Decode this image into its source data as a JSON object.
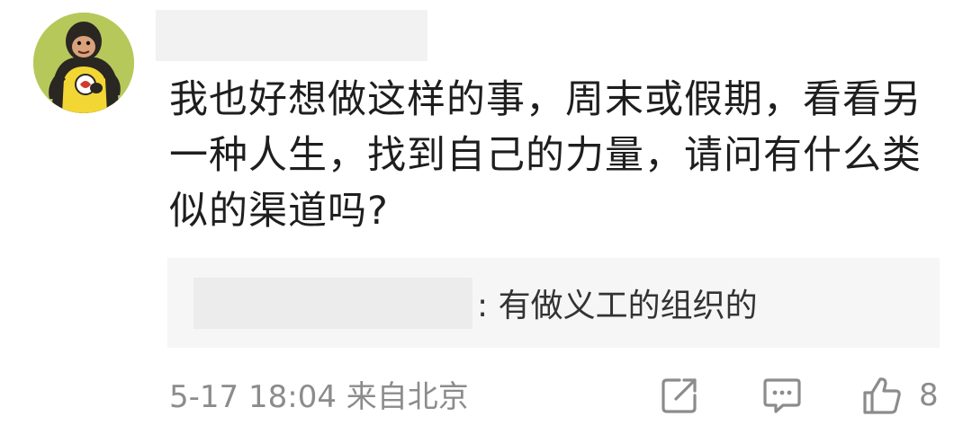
{
  "comment": {
    "body": "我也好想做这样的事，周末或假期，看看另一种人生，找到自己的力量，请问有什么类似的渠道吗?",
    "reply": {
      "text": ": 有做义工的组织的"
    },
    "meta": {
      "time_location": "5-17 18:04 来自北京",
      "like_count": "8"
    },
    "icons": {
      "avatar": "cartoon-monkey-avatar",
      "share": "share-icon",
      "comment": "comment-icon",
      "like": "thumbs-up-icon"
    },
    "colors": {
      "text": "#1e1e1e",
      "meta": "#8c8c8c",
      "reply_bg": "#f6f6f6"
    }
  }
}
